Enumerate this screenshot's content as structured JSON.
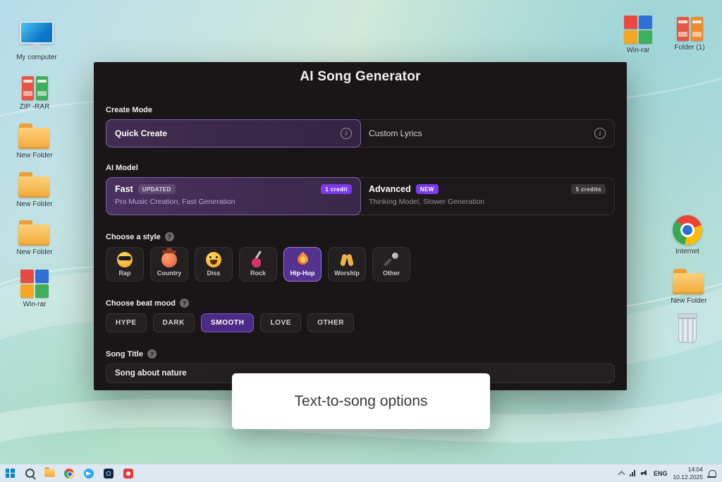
{
  "desktop": {
    "icons": [
      {
        "label": "My computer"
      },
      {
        "label": "ZIP -RAR"
      },
      {
        "label": "New Folder"
      },
      {
        "label": "New Folder"
      },
      {
        "label": "New Folder"
      },
      {
        "label": "Win-rar"
      },
      {
        "label": "Win-rar"
      },
      {
        "label": "Folder (1)"
      },
      {
        "label": "Internet"
      },
      {
        "label": "New Folder"
      }
    ]
  },
  "window": {
    "title": "AI Song Generator",
    "create_mode": {
      "label": "Create Mode",
      "tabs": [
        {
          "label": "Quick Create"
        },
        {
          "label": "Custom Lyrics"
        }
      ]
    },
    "ai_model": {
      "label": "AI Model",
      "options": [
        {
          "name": "Fast",
          "badge": "UPDATED",
          "credits": "1 credit",
          "description": "Pro Music Creation, Fast Generation"
        },
        {
          "name": "Advanced",
          "badge": "NEW",
          "credits": "5 credits",
          "description": "Thinking Model, Slower Generation"
        }
      ]
    },
    "style": {
      "label": "Choose a style",
      "options": [
        {
          "label": "Rap",
          "icon": "cool-face"
        },
        {
          "label": "Country",
          "icon": "cowboy-face"
        },
        {
          "label": "Diss",
          "icon": "laughing-face"
        },
        {
          "label": "Rock",
          "icon": "guitar"
        },
        {
          "label": "Hip-Hop",
          "icon": "flame"
        },
        {
          "label": "Worship",
          "icon": "praying-hands"
        },
        {
          "label": "Other",
          "icon": "microphone"
        }
      ]
    },
    "beat_mood": {
      "label": "Choose beat mood",
      "options": [
        {
          "label": "HYPE"
        },
        {
          "label": "DARK"
        },
        {
          "label": "SMOOTH"
        },
        {
          "label": "LOVE"
        },
        {
          "label": "OTHER"
        }
      ]
    },
    "song_title": {
      "label": "Song Title",
      "value": "Song about nature"
    },
    "glyphs": {
      "info": "i",
      "help": "?"
    }
  },
  "tooltip": {
    "text": "Text-to-song options"
  },
  "taskbar": {
    "lang": "ENG",
    "time": "14:04",
    "date": "10.12.2025"
  },
  "colors": {
    "accent_purple": "#7c3aed",
    "window_bg": "#1a1617",
    "card_bg": "#242021",
    "selected_purple_bg": "#3d2a50"
  }
}
